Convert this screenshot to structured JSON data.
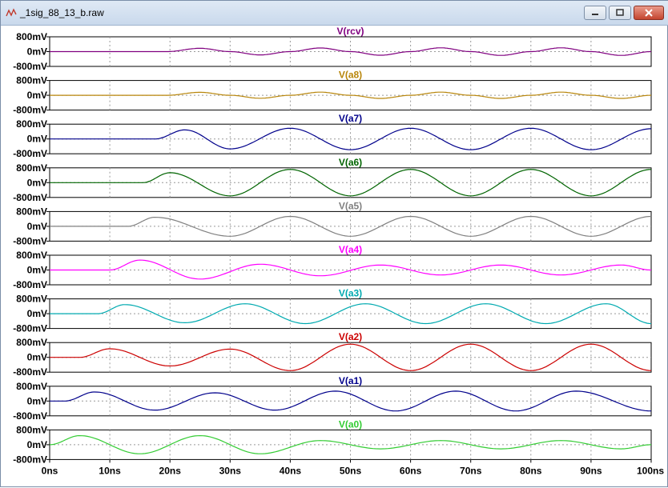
{
  "window": {
    "title": "_1sig_88_13_b.raw"
  },
  "icons": {
    "app": "waveform-app-icon",
    "minimize": "minimize-icon",
    "maximize": "maximize-icon",
    "close": "close-icon"
  },
  "chart_data": {
    "type": "line",
    "x_unit": "ns",
    "x_ticks": [
      "0ns",
      "10ns",
      "20ns",
      "30ns",
      "40ns",
      "50ns",
      "60ns",
      "70ns",
      "80ns",
      "90ns",
      "100ns"
    ],
    "xlim": [
      0,
      100
    ],
    "y_ticks": [
      "800mV",
      "0mV",
      "-800mV"
    ],
    "ylim_mV": [
      -800,
      800
    ],
    "grid": true,
    "series": [
      {
        "name": "V(rcv)",
        "color": "#800080",
        "start_ns": 19.5,
        "x_ns": [
          19.5,
          25,
          30,
          35,
          40,
          45,
          50,
          55,
          60,
          65,
          70,
          75,
          80,
          85,
          90,
          95,
          100
        ],
        "y_mV": [
          0,
          200,
          0,
          -200,
          0,
          220,
          0,
          -220,
          0,
          230,
          0,
          -230,
          0,
          230,
          0,
          -230,
          0
        ]
      },
      {
        "name": "V(a8)",
        "color": "#b8860b",
        "start_ns": 19.5,
        "x_ns": [
          19.5,
          25,
          30,
          35,
          40,
          45,
          50,
          55,
          60,
          65,
          70,
          75,
          80,
          85,
          90,
          95,
          100
        ],
        "y_mV": [
          0,
          180,
          0,
          -180,
          0,
          190,
          0,
          -190,
          0,
          190,
          0,
          -190,
          0,
          190,
          0,
          -190,
          0
        ]
      },
      {
        "name": "V(a7)",
        "color": "#00008b",
        "start_ns": 17.5,
        "x_ns": [
          17.5,
          22.5,
          30,
          40,
          50,
          60,
          70,
          80,
          90,
          100
        ],
        "y_mV": [
          0,
          550,
          -600,
          650,
          -650,
          650,
          -650,
          650,
          -650,
          620
        ]
      },
      {
        "name": "V(a6)",
        "color": "#006400",
        "start_ns": 15.5,
        "x_ns": [
          15.5,
          20,
          30,
          40,
          50,
          60,
          70,
          80,
          90,
          100
        ],
        "y_mV": [
          0,
          600,
          -800,
          800,
          -800,
          800,
          -800,
          800,
          -800,
          800
        ]
      },
      {
        "name": "V(a5)",
        "color": "#808080",
        "start_ns": 13,
        "x_ns": [
          13,
          17.5,
          30,
          40,
          50,
          60,
          70,
          80,
          90,
          100
        ],
        "y_mV": [
          0,
          550,
          -600,
          600,
          -600,
          600,
          -600,
          600,
          -600,
          600
        ]
      },
      {
        "name": "V(a4)",
        "color": "#ff00ff",
        "start_ns": 10,
        "x_ns": [
          10,
          15,
          25,
          35,
          45,
          55,
          65,
          75,
          85,
          95,
          100
        ],
        "y_mV": [
          0,
          600,
          -550,
          350,
          -350,
          300,
          -300,
          300,
          -300,
          300,
          0
        ]
      },
      {
        "name": "V(a3)",
        "color": "#00aab0",
        "start_ns": 8,
        "x_ns": [
          8,
          12.5,
          22.5,
          32.5,
          42.5,
          52.5,
          62.5,
          72.5,
          82.5,
          92.5,
          100
        ],
        "y_mV": [
          0,
          550,
          -550,
          600,
          -600,
          600,
          -600,
          600,
          -600,
          600,
          -600
        ]
      },
      {
        "name": "V(a2)",
        "color": "#cc0000",
        "start_ns": 5,
        "x_ns": [
          5,
          10,
          20,
          30,
          40,
          50,
          60,
          70,
          80,
          90,
          100
        ],
        "y_mV": [
          0,
          520,
          -520,
          500,
          -800,
          800,
          -800,
          800,
          -800,
          800,
          -800
        ]
      },
      {
        "name": "V(a1)",
        "color": "#00008b",
        "start_ns": 2.5,
        "x_ns": [
          2.5,
          7.5,
          17.5,
          27.5,
          37.5,
          47.5,
          57.5,
          67.5,
          77.5,
          87.5,
          100
        ],
        "y_mV": [
          0,
          550,
          -550,
          500,
          -550,
          600,
          -600,
          600,
          -600,
          600,
          -600
        ]
      },
      {
        "name": "V(a0)",
        "color": "#33cc33",
        "start_ns": 0,
        "x_ns": [
          0,
          5,
          15,
          25,
          35,
          45,
          55,
          65,
          75,
          85,
          95,
          100
        ],
        "y_mV": [
          0,
          550,
          -550,
          550,
          -550,
          250,
          -250,
          250,
          -250,
          250,
          -250,
          0
        ]
      }
    ]
  }
}
